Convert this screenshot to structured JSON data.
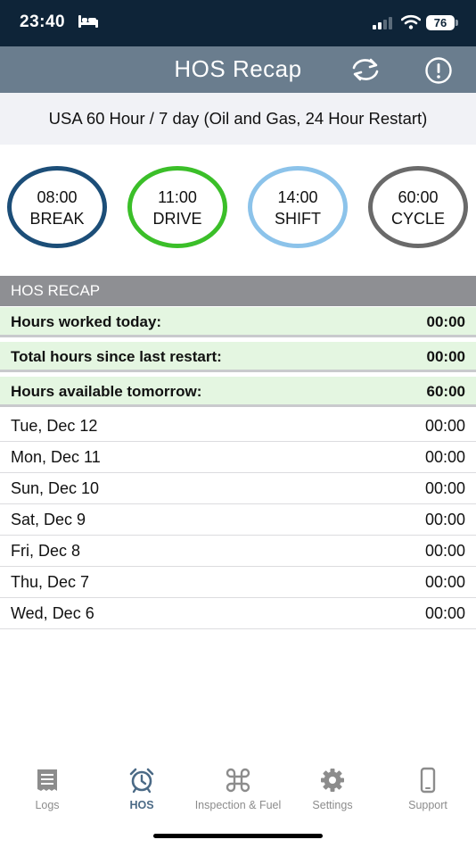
{
  "status_bar": {
    "time": "23:40",
    "battery": "76"
  },
  "header": {
    "title": "HOS Recap"
  },
  "ruleset": "USA 60 Hour / 7 day (Oil and Gas, 24 Hour Restart)",
  "gauges": [
    {
      "time": "08:00",
      "label": "BREAK",
      "color": "#1c4e78"
    },
    {
      "time": "11:00",
      "label": "DRIVE",
      "color": "#3bbf29"
    },
    {
      "time": "14:00",
      "label": "SHIFT",
      "color": "#8cc3ea"
    },
    {
      "time": "60:00",
      "label": "CYCLE",
      "color": "#6a6a6a"
    }
  ],
  "recap": {
    "heading": "HOS RECAP",
    "summary": [
      {
        "label": "Hours worked today:",
        "value": "00:00"
      },
      {
        "label": "Total hours since last restart:",
        "value": "00:00"
      },
      {
        "label": "Hours available tomorrow:",
        "value": "60:00"
      }
    ],
    "days": [
      {
        "date": "Tue, Dec 12",
        "hours": "00:00"
      },
      {
        "date": "Mon, Dec 11",
        "hours": "00:00"
      },
      {
        "date": "Sun, Dec 10",
        "hours": "00:00"
      },
      {
        "date": "Sat, Dec 9",
        "hours": "00:00"
      },
      {
        "date": "Fri, Dec 8",
        "hours": "00:00"
      },
      {
        "date": "Thu, Dec 7",
        "hours": "00:00"
      },
      {
        "date": "Wed, Dec 6",
        "hours": "00:00"
      }
    ]
  },
  "tabs": [
    {
      "label": "Logs",
      "icon": "logs-icon",
      "active": false
    },
    {
      "label": "HOS",
      "icon": "alarm-clock-icon",
      "active": true
    },
    {
      "label": "Inspection & Fuel",
      "icon": "command-icon",
      "active": false
    },
    {
      "label": "Settings",
      "icon": "gear-icon",
      "active": false
    },
    {
      "label": "Support",
      "icon": "phone-icon",
      "active": false
    }
  ],
  "colors": {
    "status_bar": "#0e2438",
    "header": "#6a7d8e",
    "recap_heading": "#8e8f93",
    "summary_row": "#e4f6e1",
    "active_tab": "#4b6a86",
    "inactive_tab": "#8c8c8c"
  }
}
